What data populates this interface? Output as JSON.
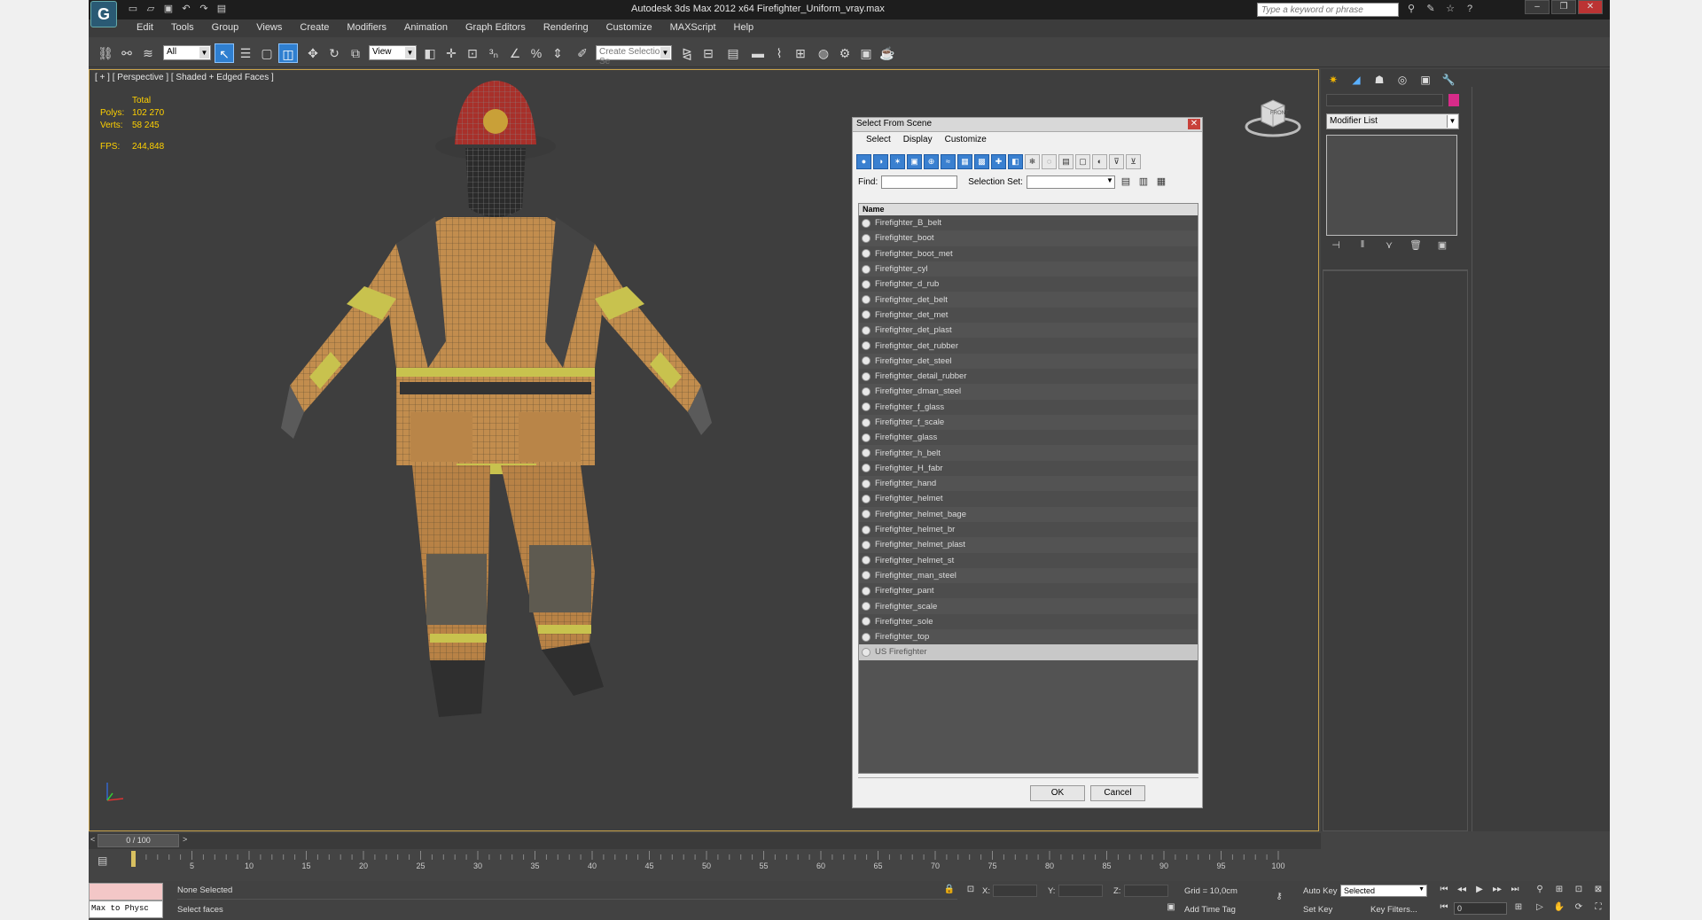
{
  "app": {
    "title": "Autodesk 3ds Max  2012 x64      Firefighter_Uniform_vray.max",
    "search_placeholder": "Type a keyword or phrase",
    "logo": "3ds Max logo"
  },
  "menubar": [
    "Edit",
    "Tools",
    "Group",
    "Views",
    "Create",
    "Modifiers",
    "Animation",
    "Graph Editors",
    "Rendering",
    "Customize",
    "MAXScript",
    "Help"
  ],
  "toolbar": {
    "filter_value": "All",
    "refcoord_value": "View",
    "named_selection_placeholder": "Create Selection Se"
  },
  "viewport": {
    "label": "[ + ] [ Perspective ] [ Shaded + Edged Faces ]",
    "stats": {
      "header": "Total",
      "polys_label": "Polys:",
      "polys_value": "102 270",
      "verts_label": "Verts:",
      "verts_value": "58 245",
      "fps_label": "FPS:",
      "fps_value": "244,848"
    },
    "viewcube_label": "FRONT"
  },
  "dialog": {
    "title": "Select From Scene",
    "menu": [
      "Select",
      "Display",
      "Customize"
    ],
    "find_label": "Find:",
    "selection_set_label": "Selection Set:",
    "column_name": "Name",
    "objects": [
      "Firefighter_B_belt",
      "Firefighter_boot",
      "Firefighter_boot_met",
      "Firefighter_cyl",
      "Firefighter_d_rub",
      "Firefighter_det_belt",
      "Firefighter_det_met",
      "Firefighter_det_plast",
      "Firefighter_det_rubber",
      "Firefighter_det_steel",
      "Firefighter_detail_rubber",
      "Firefighter_dman_steel",
      "Firefighter_f_glass",
      "Firefighter_f_scale",
      "Firefighter_glass",
      "Firefighter_h_belt",
      "Firefighter_H_fabr",
      "Firefighter_hand",
      "Firefighter_helmet",
      "Firefighter_helmet_bage",
      "Firefighter_helmet_br",
      "Firefighter_helmet_plast",
      "Firefighter_helmet_st",
      "Firefighter_man_steel",
      "Firefighter_pant",
      "Firefighter_scale",
      "Firefighter_sole",
      "Firefighter_top",
      "US Firefighter"
    ],
    "selected_object": "US Firefighter",
    "ok_label": "OK",
    "cancel_label": "Cancel"
  },
  "command_panel": {
    "tabs": [
      "create-icon",
      "modify-icon",
      "hierarchy-icon",
      "motion-icon",
      "display-icon",
      "utilities-icon"
    ],
    "modifier_list": "Modifier List",
    "color_swatch": "#d82b89"
  },
  "timeline": {
    "slider_label": "0 / 100",
    "ticks": [
      "5",
      "10",
      "15",
      "20",
      "25",
      "30",
      "35",
      "40",
      "45",
      "50",
      "55",
      "60",
      "65",
      "70",
      "75",
      "80",
      "85",
      "90",
      "95",
      "100"
    ]
  },
  "status": {
    "maxscript_text": "Max to Physc",
    "selection_status": "None Selected",
    "prompt": "Select faces",
    "x_label": "X:",
    "y_label": "Y:",
    "z_label": "Z:",
    "grid": "Grid = 10,0cm",
    "add_time_tag": "Add Time Tag",
    "auto_key": "Auto Key",
    "set_key": "Set Key",
    "selected_dropdown": "Selected",
    "key_filters": "Key Filters...",
    "frame_value": "0"
  }
}
